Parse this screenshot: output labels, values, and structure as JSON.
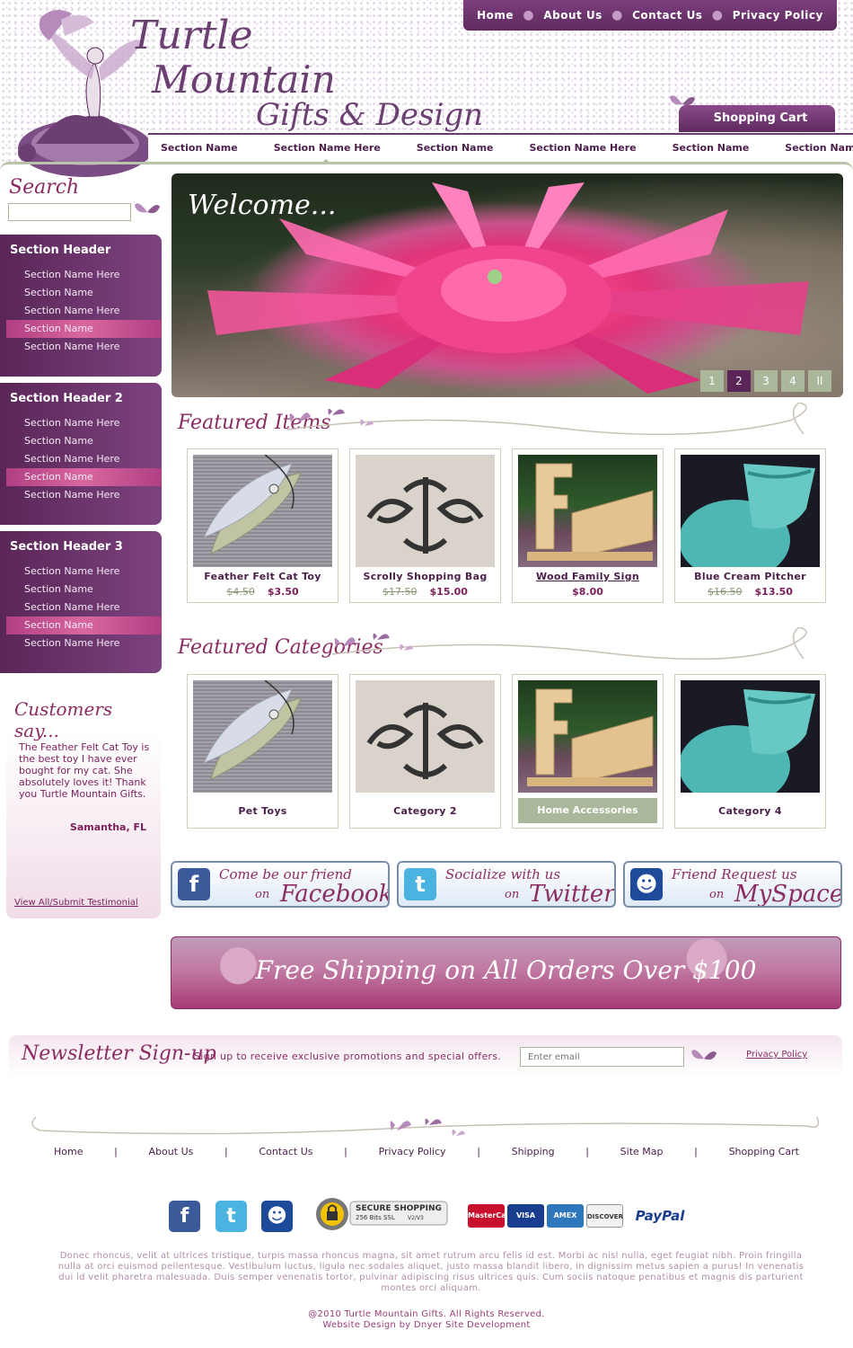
{
  "header": {
    "logo": {
      "line1": "Turtle",
      "line2": "Mountain",
      "line3": "Gifts & Design"
    },
    "top_nav": [
      "Home",
      "About Us",
      "Contact Us",
      "Privacy Policy"
    ],
    "cart_label": "Shopping Cart",
    "section_nav": [
      "Section Name",
      "Section Name Here",
      "Section Name",
      "Section Name Here",
      "Section Name",
      "Section Name Here"
    ],
    "active_section_index": 1
  },
  "sidebar": {
    "search_title": "Search",
    "search_value": "",
    "boxes": [
      {
        "title": "Section Header",
        "items": [
          "Section Name Here",
          "Section Name",
          "Section Name Here",
          "Section Name",
          "Section Name Here"
        ],
        "highlight": 3
      },
      {
        "title": "Section Header 2",
        "items": [
          "Section Name Here",
          "Section Name",
          "Section Name Here",
          "Section Name",
          "Section Name Here"
        ],
        "highlight": 3
      },
      {
        "title": "Section Header 3",
        "items": [
          "Section Name Here",
          "Section Name",
          "Section Name Here",
          "Section Name",
          "Section Name Here"
        ],
        "highlight": 3
      }
    ],
    "testimonial": {
      "title": "Customers say...",
      "quote": "The Feather Felt Cat Toy is the best toy I have ever bought for my cat. She absolutely loves it! Thank you Turtle Mountain Gifts.",
      "author": "Samantha, FL",
      "link": "View All/Submit Testimonial"
    }
  },
  "banner": {
    "caption": "Welcome...",
    "slides": [
      "1",
      "2",
      "3",
      "4",
      "II"
    ],
    "active_slide": 1
  },
  "featured_items": {
    "title": "Featured Items",
    "items": [
      {
        "name": "Feather Felt Cat Toy",
        "old_price": "$4.50",
        "price": "$3.50",
        "image": "feather-toy-image"
      },
      {
        "name": "Scrolly Shopping Bag",
        "old_price": "$17.50",
        "price": "$15.00",
        "image": "shopping-bag-image"
      },
      {
        "name": "Wood Family Sign",
        "old_price": "",
        "price": "$8.00",
        "image": "family-sign-image"
      },
      {
        "name": "Blue Cream Pitcher",
        "old_price": "$16.50",
        "price": "$13.50",
        "image": "pitcher-image"
      }
    ]
  },
  "featured_categories": {
    "title": "Featured Categories",
    "items": [
      {
        "name": "Pet Toys"
      },
      {
        "name": "Category 2"
      },
      {
        "name": "Home Accessories"
      },
      {
        "name": "Category 4"
      }
    ]
  },
  "social": [
    {
      "line1": "Come be our friend",
      "on": "on",
      "line2": "Facebook",
      "icon": "facebook-icon",
      "color": "#3b5a9a"
    },
    {
      "line1": "Socialize with us",
      "on": "on",
      "line2": "Twitter",
      "icon": "twitter-icon",
      "color": "#4bb3e0"
    },
    {
      "line1": "Friend Request us",
      "on": "on",
      "line2": "MySpace",
      "icon": "myspace-icon",
      "color": "#1d4b9a"
    }
  ],
  "shipping_banner": "Free Shipping on All Orders Over $100",
  "newsletter": {
    "title": "Newsletter Sign-up",
    "text": "Sign up to receive exclusive promotions and special offers.",
    "placeholder": "Enter email",
    "privacy": "Privacy Policy"
  },
  "footer": {
    "nav": [
      "Home",
      "About Us",
      "Contact Us",
      "Privacy Policy",
      "Shipping",
      "Site Map",
      "Shopping Cart"
    ],
    "ssl": {
      "line1": "SECURE SHOPPING",
      "line2": "256 Bits SSL",
      "line3": "V2/V3"
    },
    "cards": [
      "MasterCard",
      "VISA",
      "AMEX",
      "DISCOVER",
      "PayPal"
    ],
    "lorem": "Donec rhoncus, velit at ultrices tristique, turpis massa rhoncus magna, sit amet rutrum arcu felis id est. Morbi ac nisl nulla, eget feugiat nibh. Proin fringilla nulla at orci euismod pellentesque. Vestibulum luctus, ligula nec sodales aliquet, justo massa blandit libero, in dignissim metus sapien a purus! In venenatis dui id velit pharetra malesuada. Duis semper venenatis tortor, pulvinar adipiscing risus ultrices quis. Cum sociis natoque penatibus et magnis dis parturient montes orci aliquam.",
    "copyright": "@2010 Turtle Mountain Gifts. All Rights Reserved.",
    "credit": "Website Design by Dnyer Site Development"
  },
  "colors": {
    "plum": "#5a2657",
    "accent_pink": "#8b2c63",
    "sage": "#a9b79b"
  }
}
